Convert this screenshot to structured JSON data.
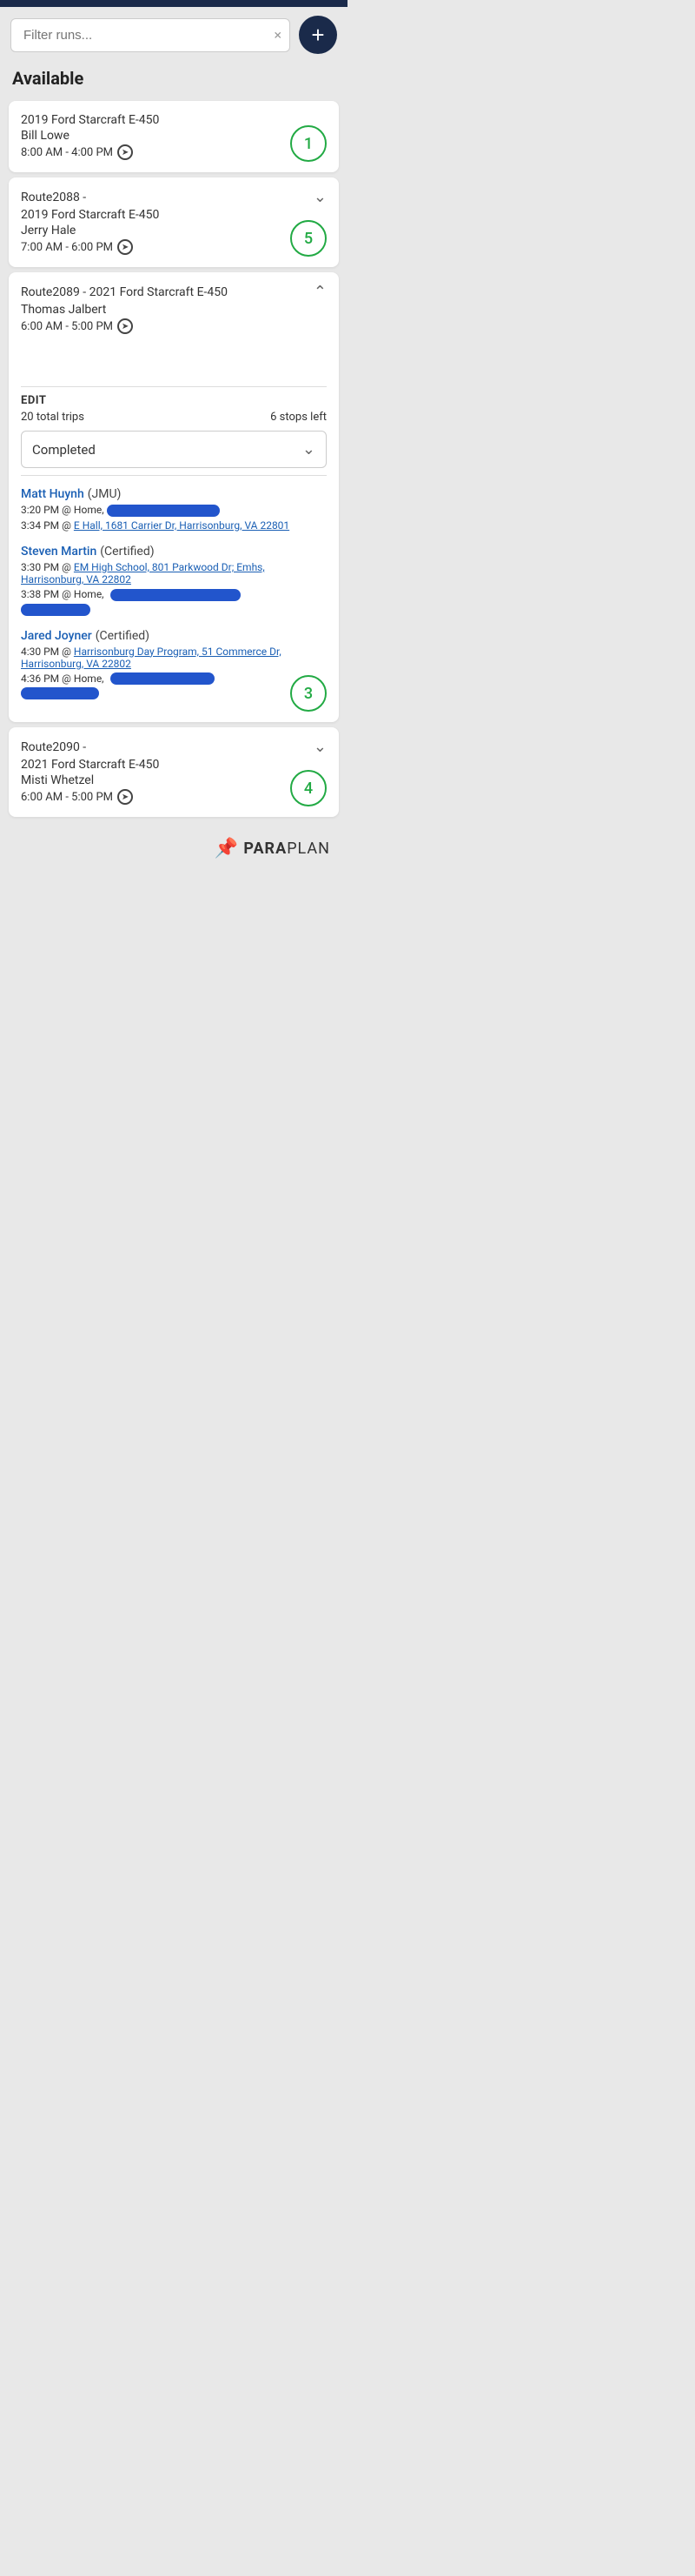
{
  "topbar": {},
  "header": {
    "filter_placeholder": "Filter runs...",
    "clear_label": "×",
    "add_label": "+"
  },
  "available_section": {
    "label": "Available"
  },
  "route_cards": [
    {
      "id": "card1",
      "route_prefix": "",
      "vehicle": "2019 Ford Starcraft E-450",
      "driver": "Bill Lowe",
      "time": "8:00 AM - 4:00 PM",
      "badge": "1",
      "expanded": false,
      "has_chevron": false
    },
    {
      "id": "card2",
      "route_prefix": "Route2088  -",
      "vehicle": "2019 Ford Starcraft E-450",
      "driver": "Jerry Hale",
      "time": "7:00 AM - 6:00 PM",
      "badge": "5",
      "expanded": false,
      "has_chevron": true
    },
    {
      "id": "card3",
      "route_prefix": "Route2089  -  2021 Ford Starcraft E-450",
      "vehicle": "",
      "driver": "Thomas Jalbert",
      "time": "6:00 AM - 5:00 PM",
      "badge": "3",
      "expanded": true,
      "has_chevron": true,
      "edit_label": "EDIT",
      "total_trips": "20 total trips",
      "stops_left": "6 stops left",
      "filter_label": "Completed",
      "passengers": [
        {
          "name": "Matt Huynh",
          "cert": "JMU",
          "stop1_time": "3:20 PM",
          "stop1_prefix": "@ Home,",
          "stop1_redact_width": 130,
          "stop2_time": "3:34 PM",
          "stop2_address": "E Hall, 1681 Carrier Dr, Harrisonburg, VA 22801",
          "stop2_redact": false
        },
        {
          "name": "Steven Martin",
          "cert": "Certified",
          "stop1_time": "3:30 PM",
          "stop1_address": "EM High School, 801 Parkwood Dr; Emhs, Harrisonburg, VA 22802",
          "stop1_redact": false,
          "stop2_time": "3:38 PM",
          "stop2_prefix": "@ Home,",
          "stop2_redact_width": 150,
          "stop2_redact2_width": 80
        },
        {
          "name": "Jared Joyner",
          "cert": "Certified",
          "stop1_time": "4:30 PM",
          "stop1_address": "Harrisonburg Day Program, 51 Commerce Dr, Harrisonburg, VA 22802",
          "stop1_redact": false,
          "stop2_time": "4:36 PM",
          "stop2_prefix": "@ Home,",
          "stop2_redact_width": 120,
          "stop2_redact2_width": 90
        }
      ]
    },
    {
      "id": "card4",
      "route_prefix": "Route2090  -",
      "vehicle": "2021 Ford Starcraft E-450",
      "driver": "Misti Whetzel",
      "time": "6:00 AM - 5:00 PM",
      "badge": "4",
      "expanded": false,
      "has_chevron": true
    }
  ],
  "footer": {
    "brand": "PARAPLAN"
  }
}
